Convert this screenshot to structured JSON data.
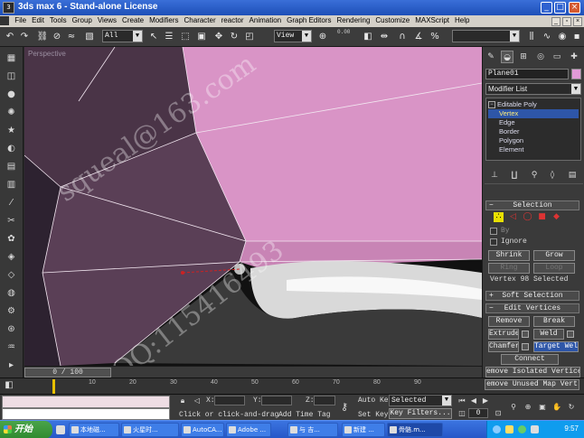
{
  "window": {
    "title": "3ds max 6 - Stand-alone License",
    "min": "_",
    "max": "□",
    "close": "×"
  },
  "menu": [
    "File",
    "Edit",
    "Tools",
    "Group",
    "Views",
    "Create",
    "Modifiers",
    "Character",
    "reactor",
    "Animation",
    "Graph Editors",
    "Rendering",
    "Customize",
    "MAXScript",
    "Help"
  ],
  "toolbar": {
    "selection_filter": "All",
    "ref_coord": "View",
    "named_sel": "",
    "small_label": "0.00"
  },
  "viewport": {
    "label": "Perspective"
  },
  "watermark": {
    "line1": "squeal@163.com",
    "line2": "QQ:115416493"
  },
  "command_panel": {
    "object_name": "Plane01",
    "object_color": "#e29ad8",
    "modifier_list": "Modifier List",
    "stack": [
      "Editable Poly",
      "Vertex",
      "Edge",
      "Border",
      "Polygon",
      "Element"
    ],
    "selection": {
      "title": "Selection",
      "by": "By",
      "ignore": "Ignore",
      "shrink": "Shrink",
      "grow": "Grow",
      "ring": "Ring",
      "loop": "Loop",
      "status": "Vertex 98 Selected"
    },
    "soft_selection": {
      "title": "Soft Selection"
    },
    "edit_vertices": {
      "title": "Edit Vertices",
      "remove": "Remove",
      "break": "Break",
      "extrude": "Extrude",
      "weld": "Weld",
      "chamfer": "Chamfer",
      "target_weld": "Target Weld",
      "connect": "Connect",
      "remove_isolated": "emove Isolated Vertice",
      "remove_unused": "emove Unused Map Vert"
    }
  },
  "time": {
    "slider": "0 / 100",
    "ticks": [
      "10",
      "20",
      "30",
      "40",
      "50",
      "60",
      "70",
      "80",
      "90"
    ]
  },
  "status": {
    "x_label": "X:",
    "y_label": "Y:",
    "z_label": "Z:",
    "prompt": "Click or click-and-drag",
    "add_time_tag": "Add Time Tag",
    "auto_key": "Auto Key",
    "auto_key_mode": "Selected",
    "set_key": "Set Key",
    "key_filters": "Key Filters...",
    "frame": "0"
  },
  "taskbar": {
    "start": "开始",
    "tasks": [
      "本地磁...",
      "火星时...",
      "AutoCA...",
      "Adobe ...",
      "与 吉...",
      "新建 ...",
      "骨骼.m..."
    ],
    "clock": "9:57"
  }
}
